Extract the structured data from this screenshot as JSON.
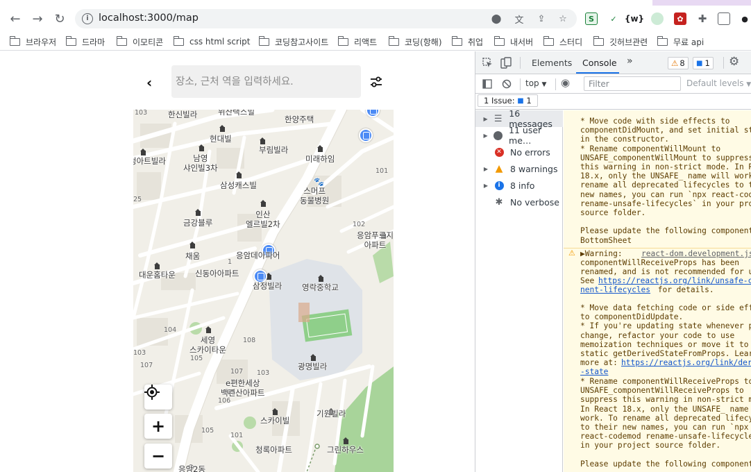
{
  "browser": {
    "url": "localhost:3000/map",
    "bookmarks": [
      "브라우저",
      "드라마",
      "이모티콘",
      "css html script",
      "코딩참고사이트",
      "리액트",
      "코딩(항해)",
      "취업",
      "내서버",
      "스터디",
      "깃허브관련",
      "무료 api"
    ]
  },
  "page": {
    "search_placeholder": "장소, 근처 역을 입력하세요.",
    "map_labels": [
      "한신빌라",
      "위산택스빌",
      "한양주택",
      "현대빌",
      "남영\n샤인빌3차",
      "부림빌라",
      "미래하임",
      "청아트빌라",
      "삼성캐스빌",
      "스머프\n동물병원",
      "인산\n엘르빌2차",
      "금강블루",
      "응암푸르지\n아파트",
      "채움",
      "응암데아파어",
      "신동아아파트",
      "대운홈타운",
      "삼정빌라",
      "영락중학교",
      "세영\n스카이타운",
      "광명빌라",
      "e편한세상\n백련산아파트",
      "스카이빌",
      "기원빌라",
      "청록아파트",
      "그린하우스",
      "응암2동"
    ],
    "map_numbers": [
      "103",
      "101",
      "25",
      "102",
      "103",
      "105",
      "108",
      "104",
      "107",
      "103",
      "107",
      "105",
      "106",
      "105",
      "101",
      "1"
    ]
  },
  "devtools": {
    "tabs": [
      "Elements",
      "Console"
    ],
    "active_tab": "Console",
    "warning_count": "8",
    "info_count": "1",
    "context": "top",
    "filter_placeholder": "Filter",
    "levels": "Default levels",
    "issues_label": "1 Issue:",
    "issues_count": "1",
    "sidebar": [
      {
        "label": "16 messages",
        "icon": "list-icon",
        "arrow": true,
        "selected": true
      },
      {
        "label": "11 user me…",
        "icon": "user-icon",
        "arrow": true,
        "selected": false
      },
      {
        "label": "No errors",
        "icon": "error-icon",
        "arrow": false,
        "selected": false
      },
      {
        "label": "8 warnings",
        "icon": "warning-icon",
        "arrow": true,
        "selected": false
      },
      {
        "label": "8 info",
        "icon": "info-icon",
        "arrow": true,
        "selected": false
      },
      {
        "label": "No verbose",
        "icon": "bug-icon",
        "arrow": false,
        "selected": false
      }
    ],
    "console_block1": "* Move code with side effects to\ncomponentDidMount, and set initial sta\nin the constructor.\n* Rename componentWillMount to\nUNSAFE_componentWillMount to suppress\nthis warning in non-strict mode. In Re\n18.x, only the UNSAFE_ name will work\nrename all deprecated lifecycles to th\nnew names, you can run `npx react-code\nrename-unsafe-lifecycles` in your proj\nsource folder.\n\nPlease update the following components\nBottomSheet",
    "console_warning_label": "▶Warning:",
    "console_warning_source": "react-dom.development.js",
    "console_warning_text": "componentWillReceiveProps has been\nrenamed, and is not recommended for us\nSee",
    "console_link1": "https://reactjs.org/link/unsafe-co",
    "console_link1b": "nent-lifecycles",
    "console_for_details": " for details.",
    "console_block2": "* Move data fetching code or side effe\nto componentDidUpdate.\n* If you're updating state whenever p\nchange, refactor your code to use\nmemoization techniques or move it to\nstatic getDerivedStateFromProps. Learn\nmore at:",
    "console_link2": "https://reactjs.org/link/der",
    "console_link2b": "-state",
    "console_block3": "* Rename componentWillReceiveProps to\nUNSAFE_componentWillReceiveProps to\nsuppress this warning in non-strict mo\nIn React 18.x, only the UNSAFE_ name w\nwork. To rename all deprecated lifecyc\nto their new names, you can run `npx\nreact-codemod rename-unsafe-lifecycles\nin your project source folder.\n\nPlease update the following components"
  }
}
